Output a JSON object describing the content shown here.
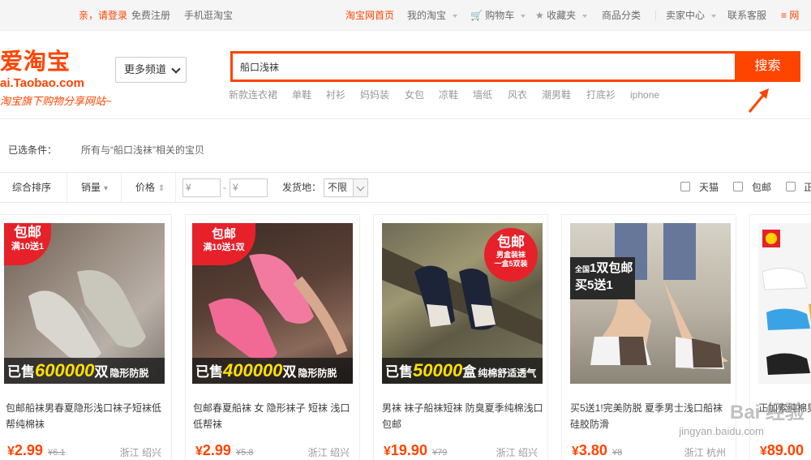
{
  "topbar": {
    "greeting": "亲，请登录",
    "register": "免费注册",
    "mobile": "手机逛淘宝",
    "home": "淘宝网首页",
    "my_taobao": "我的淘宝",
    "cart": "购物车",
    "favorites": "收藏夹",
    "categories": "商品分类",
    "seller_center": "卖家中心",
    "customer_service": "联系客服"
  },
  "header": {
    "logo": "爱淘宝",
    "logo_domain": "ai.Taobao.com",
    "slogan": "淘宝旗下购物分享网站",
    "more_channels": "更多频道",
    "search_value": "船口浅袜",
    "search_button": "搜索",
    "hot_words": [
      "新款连衣裙",
      "单鞋",
      "衬衫",
      "妈妈装",
      "女包",
      "凉鞋",
      "墙纸",
      "风衣",
      "潮男鞋",
      "打底衫",
      "iphone"
    ]
  },
  "filter": {
    "label": "已选条件：",
    "text": "所有与“船口浅袜”相关的宝贝"
  },
  "sortbar": {
    "comprehensive": "综合排序",
    "sales": "销量",
    "price": "价格",
    "price_min_placeholder": "¥",
    "price_max_placeholder": "¥",
    "dash": "-",
    "ship_from_label": "发货地：",
    "ship_from_value": "不限",
    "tmall": "天猫",
    "free_shipping": "包邮",
    "genuine": "正"
  },
  "products": [
    {
      "title": "包邮船袜男春夏隐形浅口袜子短袜低帮纯棉袜",
      "price": "2.99",
      "orig": "¥6.1",
      "location": "浙江 绍兴",
      "badge_main": "包邮",
      "badge_sub": "满10送1",
      "sold_prefix": "已售",
      "sold_num": "600000",
      "sold_unit": "双",
      "sold_tag": "隐形防脱"
    },
    {
      "title": "包邮春夏船袜 女 隐形袜子 短袜 浅口低帮袜",
      "price": "2.99",
      "orig": "¥5.8",
      "location": "浙江 绍兴",
      "badge_main": "包邮",
      "badge_sub": "满10送1双",
      "sold_prefix": "已售",
      "sold_num": "400000",
      "sold_unit": "双",
      "sold_tag": "隐形防脱"
    },
    {
      "title": "男袜 袜子船袜短袜 防臭夏季纯棉浅口包邮",
      "price": "19.90",
      "orig": "¥79",
      "location": "浙江 绍兴",
      "badge_main": "包邮",
      "badge_sub": "男盒装袜",
      "badge_sub2": "一盒5双装",
      "sold_prefix": "已售",
      "sold_num": "50000",
      "sold_unit": "盒",
      "sold_tag": "纯棉舒适透气"
    },
    {
      "title": "买5送1!完美防脱 夏季男士浅口船袜硅胶防滑",
      "price": "3.80",
      "orig": "¥8",
      "location": "浙江 杭州",
      "badge_main": "全国",
      "badge_sub": "1双包邮",
      "badge_sub2": "买5送1"
    },
    {
      "title": "正加索纯棉男",
      "price": "89.00",
      "orig": "",
      "location": ""
    }
  ],
  "watermark": {
    "text": "Bai 经验",
    "url": "jingyan.baidu.com"
  },
  "colors": {
    "brand": "#ff4400",
    "price": "#ff4400",
    "sold_highlight": "#ffe000"
  }
}
